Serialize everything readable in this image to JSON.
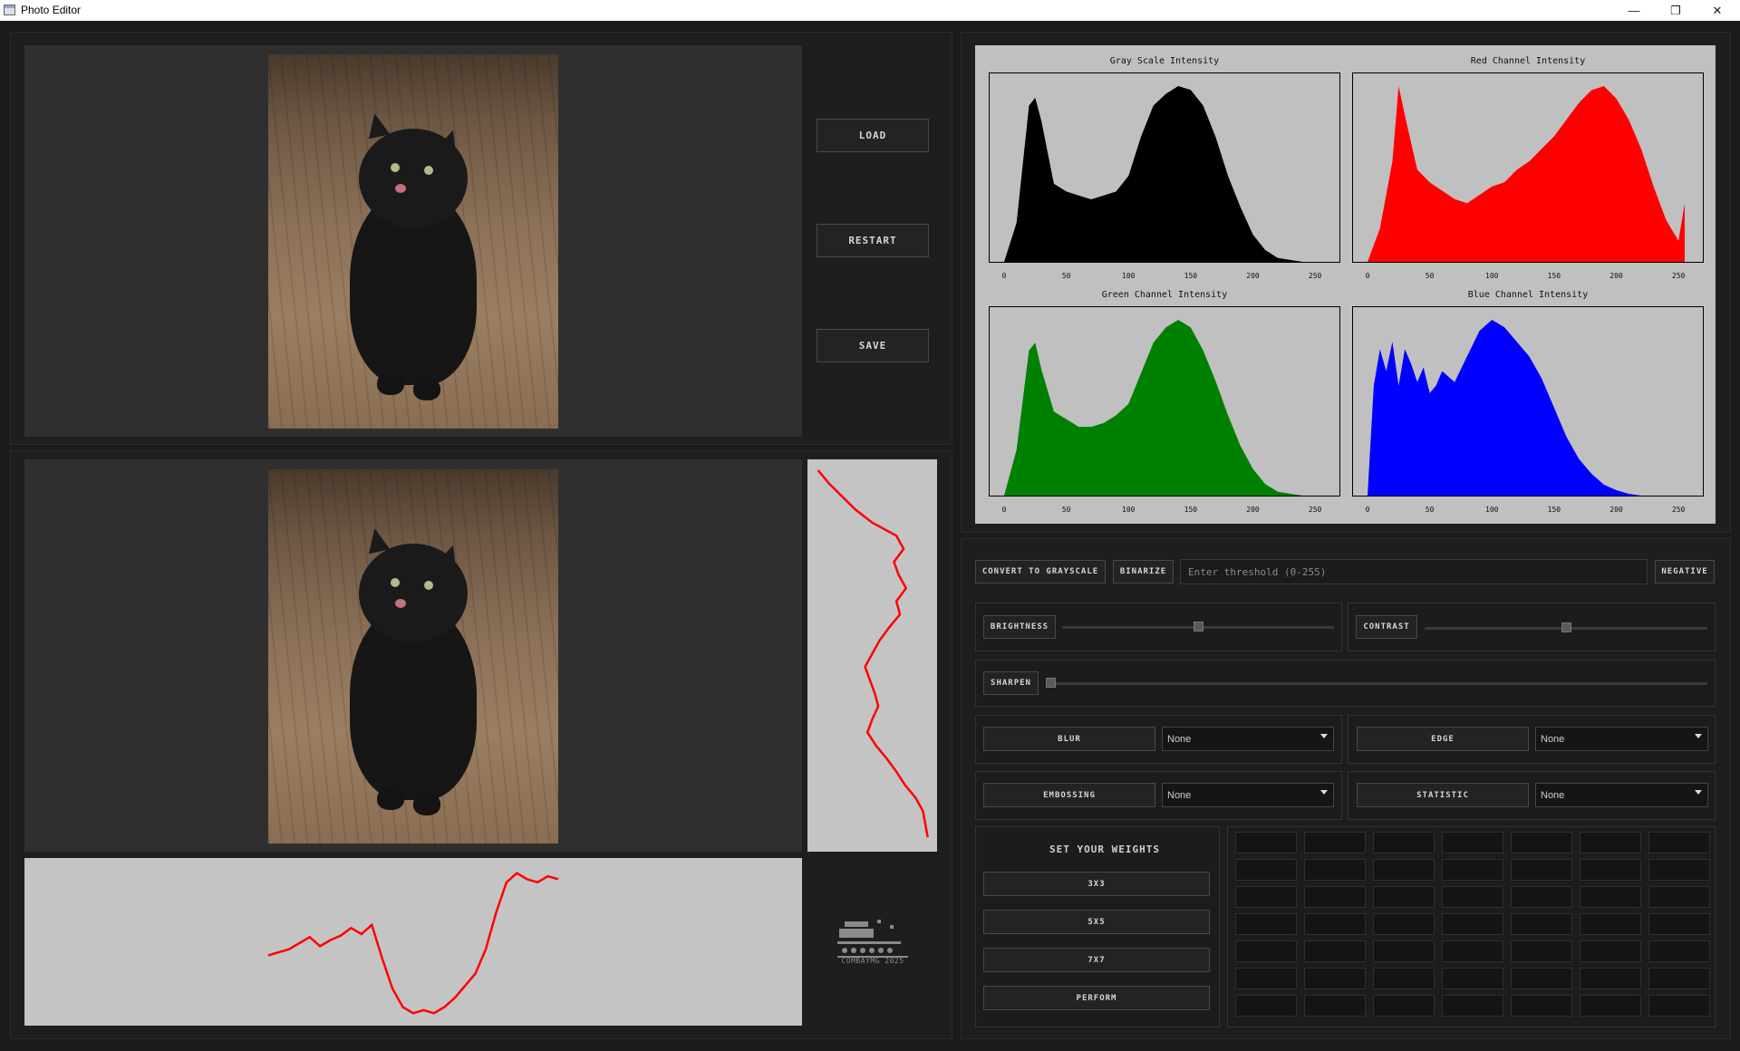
{
  "window": {
    "title": "Photo Editor",
    "controls": [
      "—",
      "❐",
      "✕"
    ]
  },
  "buttons": {
    "load": "LOAD",
    "restart": "RESTART",
    "save": "SAVE"
  },
  "histograms": [
    {
      "title": "Gray Scale Intensity",
      "color": "#000000"
    },
    {
      "title": "Red Channel Intensity",
      "color": "#ff0000"
    },
    {
      "title": "Green Channel Intensity",
      "color": "#008000"
    },
    {
      "title": "Blue Channel Intensity",
      "color": "#0000ff"
    }
  ],
  "histogram_ticks": [
    "0",
    "50",
    "100",
    "150",
    "200",
    "250"
  ],
  "chart_data": [
    {
      "type": "area",
      "title": "Gray Scale Intensity",
      "x": [
        0,
        10,
        20,
        25,
        30,
        40,
        50,
        60,
        70,
        80,
        90,
        100,
        110,
        120,
        130,
        140,
        150,
        160,
        170,
        180,
        190,
        200,
        210,
        220,
        230,
        240,
        250
      ],
      "values": [
        0,
        10,
        40,
        42,
        36,
        20,
        18,
        17,
        16,
        17,
        18,
        22,
        32,
        40,
        43,
        45,
        44,
        40,
        32,
        22,
        14,
        7,
        3,
        1,
        0.5,
        0,
        0
      ],
      "xlim": [
        0,
        255
      ]
    },
    {
      "type": "area",
      "title": "Red Channel Intensity",
      "x": [
        0,
        10,
        20,
        25,
        30,
        40,
        50,
        60,
        70,
        80,
        90,
        100,
        110,
        120,
        130,
        140,
        150,
        160,
        170,
        180,
        190,
        200,
        210,
        220,
        230,
        240,
        250,
        255
      ],
      "values": [
        0,
        8,
        24,
        42,
        35,
        22,
        19,
        17,
        15,
        14,
        16,
        18,
        19,
        22,
        24,
        27,
        30,
        34,
        38,
        41,
        42,
        39,
        34,
        27,
        18,
        10,
        5,
        14
      ],
      "xlim": [
        0,
        255
      ]
    },
    {
      "type": "area",
      "title": "Green Channel Intensity",
      "x": [
        0,
        10,
        20,
        25,
        30,
        40,
        50,
        60,
        70,
        80,
        90,
        100,
        110,
        120,
        130,
        140,
        150,
        160,
        170,
        180,
        190,
        200,
        210,
        220,
        230,
        240,
        250
      ],
      "values": [
        0,
        12,
        38,
        40,
        33,
        22,
        20,
        18,
        18,
        19,
        21,
        24,
        32,
        40,
        44,
        46,
        44,
        38,
        30,
        21,
        13,
        7,
        3,
        1,
        0.5,
        0,
        0
      ],
      "xlim": [
        0,
        255
      ]
    },
    {
      "type": "area",
      "title": "Blue Channel Intensity",
      "x": [
        0,
        5,
        10,
        15,
        20,
        25,
        30,
        35,
        40,
        45,
        50,
        55,
        60,
        70,
        80,
        90,
        100,
        110,
        120,
        130,
        140,
        150,
        160,
        170,
        180,
        190,
        200,
        210,
        220
      ],
      "values": [
        0,
        30,
        40,
        34,
        42,
        30,
        40,
        36,
        31,
        35,
        28,
        30,
        34,
        31,
        38,
        45,
        48,
        46,
        42,
        38,
        32,
        24,
        16,
        10,
        6,
        3,
        1.5,
        0.5,
        0
      ],
      "xlim": [
        0,
        255
      ]
    }
  ],
  "profiles": {
    "vertical_color": "#ff0000",
    "horizontal_color": "#ff0000",
    "vertical": [
      5,
      14,
      25,
      36,
      50,
      70,
      76,
      68,
      72,
      78,
      70,
      73,
      64,
      56,
      50,
      44,
      48,
      52,
      55,
      50,
      46,
      53,
      62,
      70,
      77,
      86,
      92,
      94,
      96
    ],
    "horizontal": [
      42,
      44,
      46,
      50,
      54,
      48,
      52,
      55,
      60,
      56,
      62,
      40,
      20,
      8,
      4,
      6,
      4,
      8,
      14,
      22,
      30,
      46,
      70,
      90,
      96,
      92,
      90,
      94,
      92
    ]
  },
  "toolbar": {
    "grayscale": "CONVERT TO GRAYSCALE",
    "binarize": "BINARIZE",
    "threshold_placeholder": "Enter threshold (0-255)",
    "negative": "NEGATIVE"
  },
  "sliders": {
    "brightness": {
      "label": "BRIGHTNESS",
      "value": 0.5
    },
    "contrast": {
      "label": "CONTRAST",
      "value": 0.5
    },
    "sharpen": {
      "label": "SHARPEN",
      "value": 0.0
    }
  },
  "filters": {
    "blur": {
      "label": "BLUR",
      "selected": "None"
    },
    "edge": {
      "label": "EDGE",
      "selected": "None"
    },
    "embossing": {
      "label": "EMBOSSING",
      "selected": "None"
    },
    "statistic": {
      "label": "STATISTIC",
      "selected": "None"
    }
  },
  "weights": {
    "title": "SET YOUR WEIGHTS",
    "size_3": "3X3",
    "size_5": "5X5",
    "size_7": "7X7",
    "perform": "PERFORM",
    "grid_rows": 7,
    "grid_cols": 7
  },
  "logo_text": "COMBAYMG 2025"
}
